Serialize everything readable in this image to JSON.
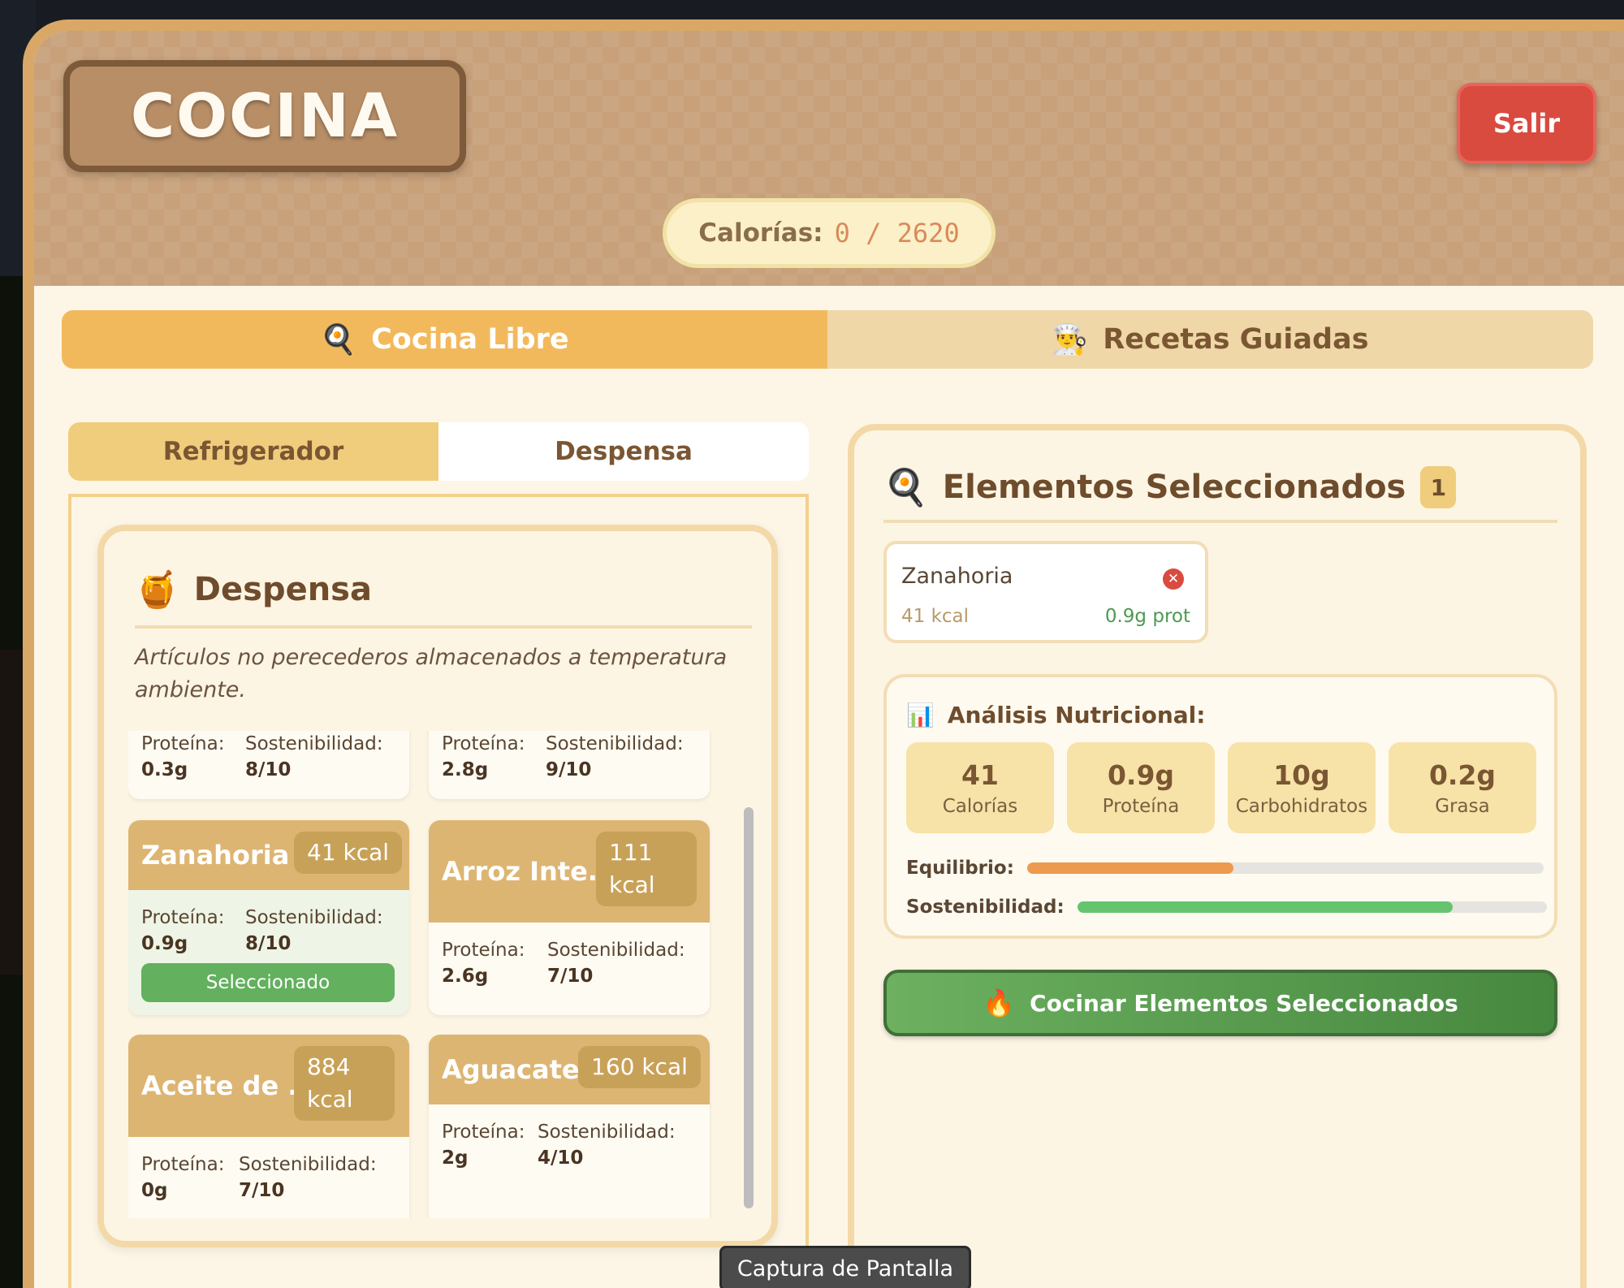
{
  "header": {
    "title": "COCINA",
    "exit_label": "Salir",
    "calories_label": "Calorías:",
    "calories_value": "0 / 2620"
  },
  "mode_tabs": [
    {
      "icon": "🍳",
      "icon_name": "frying-pan-icon",
      "label": "Cocina Libre",
      "active": true
    },
    {
      "icon": "👨‍🍳",
      "icon_name": "chef-icon",
      "label": "Recetas Guiadas",
      "active": false
    }
  ],
  "storage_tabs": [
    {
      "label": "Refrigerador",
      "active": true
    },
    {
      "label": "Despensa",
      "active": false
    }
  ],
  "pantry": {
    "icon": "🍯",
    "icon_name": "honey-pot-icon",
    "title": "Despensa",
    "description": "Artículos no perecederos almacenados a temperatura ambiente.",
    "items": [
      {
        "protein_label": "Proteína:",
        "protein": "0.3g",
        "sust_label": "Sostenibilidad:",
        "sust": "8/10"
      },
      {
        "protein_label": "Proteína:",
        "protein": "2.8g",
        "sust_label": "Sostenibilidad:",
        "sust": "9/10"
      },
      {
        "name": "Zanahoria",
        "kcal": "41 kcal",
        "protein_label": "Proteína:",
        "protein": "0.9g",
        "sust_label": "Sostenibilidad:",
        "sust": "8/10",
        "selected_label": "Seleccionado"
      },
      {
        "name": "Arroz Inte...",
        "kcal": "111 kcal",
        "protein_label": "Proteína:",
        "protein": "2.6g",
        "sust_label": "Sostenibilidad:",
        "sust": "7/10"
      },
      {
        "name": "Aceite de ...",
        "kcal": "884 kcal",
        "protein_label": "Proteína:",
        "protein": "0g",
        "sust_label": "Sostenibilidad:",
        "sust": "7/10"
      },
      {
        "name": "Aguacate",
        "kcal": "160 kcal",
        "protein_label": "Proteína:",
        "protein": "2g",
        "sust_label": "Sostenibilidad:",
        "sust": "4/10"
      }
    ]
  },
  "selected": {
    "icon": "🍳",
    "icon_name": "frying-pan-icon",
    "title": "Elementos Seleccionados",
    "count": "1",
    "items": [
      {
        "name": "Zanahoria",
        "kcal": "41 kcal",
        "protein": "0.9g prot"
      }
    ],
    "analysis": {
      "icon": "📊",
      "icon_name": "bar-chart-icon",
      "title": "Análisis Nutricional:",
      "tiles": [
        {
          "value": "41",
          "label": "Calorías"
        },
        {
          "value": "0.9g",
          "label": "Proteína"
        },
        {
          "value": "10g",
          "label": "Carbohidratos"
        },
        {
          "value": "0.2g",
          "label": "Grasa"
        }
      ],
      "balance_label": "Equilibrio:",
      "balance_level": 0.4,
      "balance_color": "#ec9a4e",
      "sustainability_label": "Sostenibilidad:",
      "sustainability_level": 0.8,
      "sustainability_color": "#65c46d"
    },
    "cook_icon": "🔥",
    "cook_icon_name": "fire-icon",
    "cook_label": "Cocinar Elementos Seleccionados"
  },
  "tooltip": "Captura de Pantalla"
}
